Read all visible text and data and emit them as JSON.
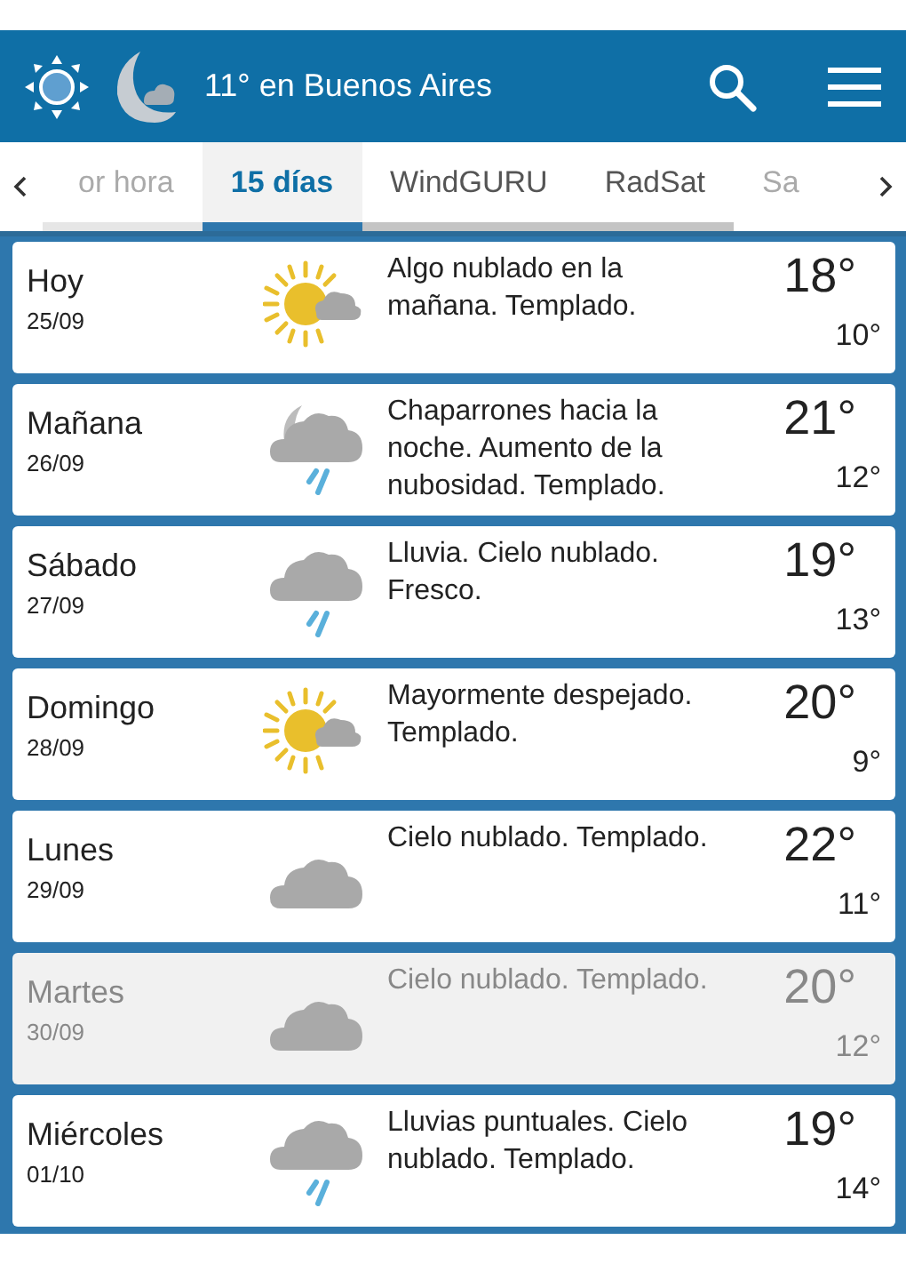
{
  "header": {
    "title": "11° en Buenos Aires"
  },
  "tabs": [
    {
      "label": "or hora",
      "selected": false
    },
    {
      "label": "15 días",
      "selected": true
    },
    {
      "label": "WindGURU",
      "selected": false
    },
    {
      "label": "RadSat",
      "selected": false
    },
    {
      "label": "Sa",
      "selected": false
    }
  ],
  "days": [
    {
      "day": "Hoy",
      "date": "25/09",
      "kind": "partly",
      "text": "Algo nublado en la mañana. Templado.",
      "max": "18°",
      "min": "10°",
      "selected": false
    },
    {
      "day": "Mañana",
      "date": "26/09",
      "kind": "showers",
      "text": "Chaparrones hacia la noche. Aumento de la nubosidad. Templado.",
      "max": "21°",
      "min": "12°",
      "selected": false
    },
    {
      "day": "Sábado",
      "date": "27/09",
      "kind": "rain",
      "text": "Lluvia. Cielo nublado. Fresco.",
      "max": "19°",
      "min": "13°",
      "selected": false
    },
    {
      "day": "Domingo",
      "date": "28/09",
      "kind": "partly",
      "text": "Mayormente despejado. Templado.",
      "max": "20°",
      "min": "9°",
      "selected": false
    },
    {
      "day": "Lunes",
      "date": "29/09",
      "kind": "cloudy",
      "text": "Cielo nublado. Templado.",
      "max": "22°",
      "min": "11°",
      "selected": false
    },
    {
      "day": "Martes",
      "date": "30/09",
      "kind": "cloudy",
      "text": "Cielo nublado. Templado.",
      "max": "20°",
      "min": "12°",
      "selected": true
    },
    {
      "day": "Miércoles",
      "date": "01/10",
      "kind": "rain",
      "text": "Lluvias puntuales. Cielo nublado. Templado.",
      "max": "19°",
      "min": "14°",
      "selected": false
    }
  ]
}
